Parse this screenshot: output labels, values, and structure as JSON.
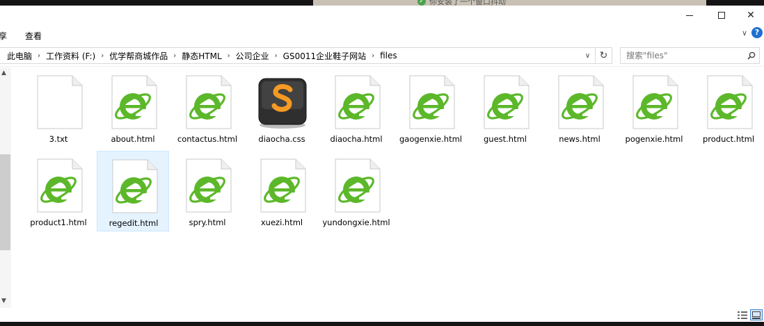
{
  "notification": {
    "text": "你安装了一个窗口抖动"
  },
  "ribbon": {
    "tabs": [
      "享",
      "查看"
    ]
  },
  "address": {
    "crumbs": [
      "此电脑",
      "工作资料 (F:)",
      "优学帮商城作品",
      "静态HTML",
      "公司企业",
      "GS0011企业鞋子网站",
      "files"
    ]
  },
  "search": {
    "placeholder": "搜索\"files\""
  },
  "files": [
    {
      "name": "3.txt",
      "type": "txt"
    },
    {
      "name": "about.html",
      "type": "html"
    },
    {
      "name": "contactus.html",
      "type": "html"
    },
    {
      "name": "diaocha.css",
      "type": "css"
    },
    {
      "name": "diaocha.html",
      "type": "html"
    },
    {
      "name": "gaogenxie.html",
      "type": "html"
    },
    {
      "name": "guest.html",
      "type": "html"
    },
    {
      "name": "news.html",
      "type": "html"
    },
    {
      "name": "pogenxie.html",
      "type": "html"
    },
    {
      "name": "product.html",
      "type": "html"
    },
    {
      "name": "product1.html",
      "type": "html"
    },
    {
      "name": "regedit.html",
      "type": "html",
      "selected": true
    },
    {
      "name": "spry.html",
      "type": "html"
    },
    {
      "name": "xuezi.html",
      "type": "html"
    },
    {
      "name": "yundongxie.html",
      "type": "html"
    }
  ],
  "colors": {
    "selection": "#e5f3ff",
    "ie_green": "#5cb82a",
    "sublime_orange": "#f59a23"
  }
}
